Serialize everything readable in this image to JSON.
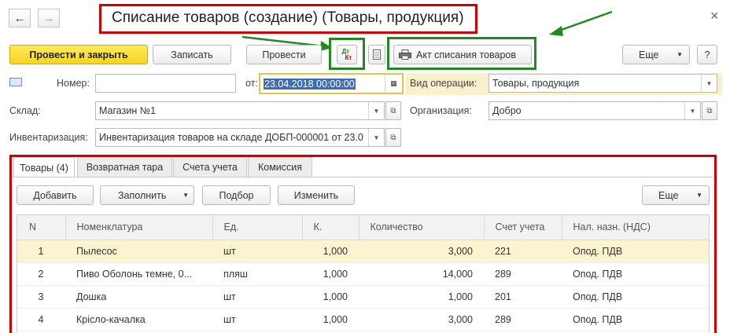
{
  "window": {
    "title": "Списание товаров (создание) (Товары, продукция)",
    "close": "×"
  },
  "nav": {
    "back": "←",
    "forward": "→"
  },
  "toolbar": {
    "post_close": "Провести и закрыть",
    "save": "Записать",
    "post": "Провести",
    "dtkt_icon_text_top": "Дт",
    "dtkt_icon_text_bottom": "Кт",
    "print_act": "Акт списания товаров",
    "more": "Еще",
    "help": "?"
  },
  "form": {
    "number_label": "Номер:",
    "number_value": "",
    "date_label": "от:",
    "date_value": "23.04.2018 00:00:00",
    "operation_label": "Вид операции:",
    "operation_value": "Товары, продукция",
    "warehouse_label": "Склад:",
    "warehouse_value": "Магазин №1",
    "org_label": "Организация:",
    "org_value": "Добро",
    "inventory_label": "Инвентаризация:",
    "inventory_value": "Инвентаризация товаров на складе ДОБП-000001 от 23.0"
  },
  "tabs": [
    {
      "label": "Товары (4)"
    },
    {
      "label": "Возвратная тара"
    },
    {
      "label": "Счета учета"
    },
    {
      "label": "Комиссия"
    }
  ],
  "table_toolbar": {
    "add": "Добавить",
    "fill": "Заполнить",
    "pick": "Подбор",
    "change": "Изменить",
    "more": "Еще"
  },
  "table": {
    "headers": [
      "N",
      "Номенклатура",
      "Ед.",
      "К.",
      "Количество",
      "Счет учета",
      "Нал. назн. (НДС)"
    ],
    "rows": [
      [
        "1",
        "Пылесос",
        "шт",
        "1,000",
        "3,000",
        "221",
        "Опод. ПДВ"
      ],
      [
        "2",
        "Пиво Оболонь темне, 0...",
        "пляш",
        "1,000",
        "14,000",
        "289",
        "Опод. ПДВ"
      ],
      [
        "3",
        "Дошка",
        "шт",
        "1,000",
        "1,000",
        "201",
        "Опод. ПДВ"
      ],
      [
        "4",
        "Крісло-качалка",
        "шт",
        "1,000",
        "3,000",
        "289",
        "Опод. ПДВ"
      ]
    ]
  },
  "colors": {
    "accent_yellow": "#f7d51b",
    "highlight_red": "#d40000",
    "highlight_green": "#208a20",
    "selected_row": "#fbf4cf"
  }
}
